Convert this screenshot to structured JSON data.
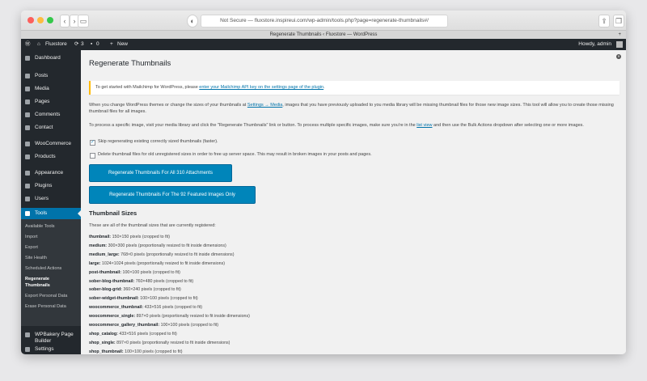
{
  "browser": {
    "url": "Not Secure — fluxstore.inspireui.com/wp-admin/tools.php?page=regenerate-thumbnails#/",
    "tab_title": "Regenerate Thumbnails ‹ Fluxstore — WordPress",
    "new_tab": "+"
  },
  "adminbar": {
    "site": "Fluxstore",
    "updates": "3",
    "comments": "0",
    "new": "New",
    "howdy": "Howdy, admin"
  },
  "sidebar": {
    "items": [
      {
        "label": "Dashboard"
      },
      {
        "label": "Posts"
      },
      {
        "label": "Media"
      },
      {
        "label": "Pages"
      },
      {
        "label": "Comments"
      },
      {
        "label": "Contact"
      },
      {
        "label": "WooCommerce"
      },
      {
        "label": "Products"
      },
      {
        "label": "Appearance"
      },
      {
        "label": "Plugins"
      },
      {
        "label": "Users"
      },
      {
        "label": "Tools"
      },
      {
        "label": "WPBakery Page"
      },
      {
        "label": "Builder"
      },
      {
        "label": "Settings"
      }
    ],
    "sub": [
      "Available Tools",
      "Import",
      "Export",
      "Site Health",
      "Scheduled Actions",
      "Regenerate",
      "Thumbnails",
      "Export Personal Data",
      "Erase Personal Data"
    ]
  },
  "page": {
    "title": "Regenerate Thumbnails",
    "notice_text": "To get started with Mailchimp for WordPress, please",
    "notice_link": "enter your Mailchimp API key on the settings page of the plugin",
    "notice_end": ".",
    "intro1a": "When you change WordPress themes or change the sizes of your thumbnails at",
    "intro1_link": "Settings → Media",
    "intro1b": ", images that you have previously uploaded to you media library will be missing thumbnail files for those new image sizes. This tool will",
    "intro1c": "allow you to create those missing thumbnail files for all images.",
    "intro2a": "To process a specific image, visit your media library and click the \"Regenerate Thumbnails\" link or button. To process multiple specific images, make sure you're in the",
    "intro2_link": "list view",
    "intro2b": "and then use the Bulk Actions dropdown after selecting",
    "intro2c": "one or more images.",
    "opt1": "Skip regenerating existing correctly sized thumbnails (faster).",
    "opt2": "Delete thumbnail files for old unregistered sizes in order to free up server space. This may result in broken images in your posts and pages.",
    "btn_all": "Regenerate Thumbnails For All 310 Attachments",
    "btn_featured": "Regenerate Thumbnails For The 92 Featured Images Only",
    "sizes_heading": "Thumbnail Sizes",
    "sizes_intro": "These are all of the thumbnail sizes that are currently registered:",
    "sizes": [
      {
        "name": "thumbnail:",
        "desc": "150×150 pixels (cropped to fit)"
      },
      {
        "name": "medium:",
        "desc": "300×300 pixels (proportionally resized to fit inside dimensions)"
      },
      {
        "name": "medium_large:",
        "desc": "768×0 pixels (proportionally resized to fit inside dimensions)"
      },
      {
        "name": "large:",
        "desc": "1024×1024 pixels (proportionally resized to fit inside dimensions)"
      },
      {
        "name": "post-thumbnail:",
        "desc": "100×100 pixels (cropped to fit)"
      },
      {
        "name": "sober-blog-thumbnail:",
        "desc": "760×480 pixels (cropped to fit)"
      },
      {
        "name": "sober-blog-grid:",
        "desc": "360×240 pixels (cropped to fit)"
      },
      {
        "name": "sober-widget-thumbnail:",
        "desc": "100×100 pixels (cropped to fit)"
      },
      {
        "name": "woocommerce_thumbnail:",
        "desc": "433×516 pixels (cropped to fit)"
      },
      {
        "name": "woocommerce_single:",
        "desc": "897×0 pixels (proportionally resized to fit inside dimensions)"
      },
      {
        "name": "woocommerce_gallery_thumbnail:",
        "desc": "100×100 pixels (cropped to fit)"
      },
      {
        "name": "shop_catalog:",
        "desc": "433×516 pixels (cropped to fit)"
      },
      {
        "name": "shop_single:",
        "desc": "897×0 pixels (proportionally resized to fit inside dimensions)"
      },
      {
        "name": "shop_thumbnail:",
        "desc": "100×100 pixels (cropped to fit)"
      }
    ]
  }
}
